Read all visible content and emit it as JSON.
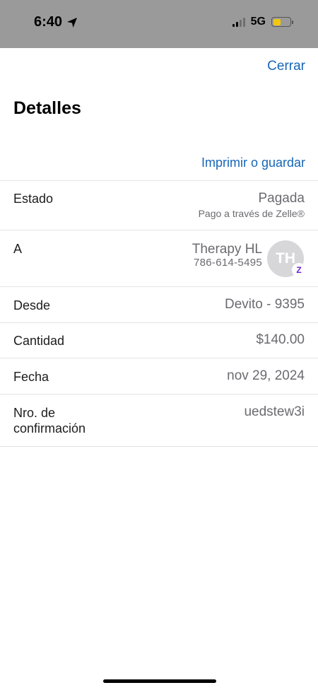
{
  "status_bar": {
    "time": "6:40",
    "network": "5G",
    "battery_level": 0.45,
    "colors": {
      "battery_fill": "#f2c70d",
      "bar_bg": "#9a9a9a"
    },
    "icons": [
      "location-arrow-icon",
      "signal-icon",
      "battery-icon"
    ]
  },
  "header": {
    "close_label": "Cerrar",
    "title": "Detalles",
    "print_label": "Imprimir o guardar"
  },
  "details": {
    "estado": {
      "label": "Estado",
      "value": "Pagada",
      "sub": "Pago a través de Zelle®"
    },
    "a": {
      "label": "A",
      "name": "Therapy HL",
      "phone": "786-614-5495",
      "avatar_initials": "TH",
      "badge": "Z"
    },
    "desde": {
      "label": "Desde",
      "value": "Devito - 9395"
    },
    "cantidad": {
      "label": "Cantidad",
      "value": "$140.00"
    },
    "fecha": {
      "label": "Fecha",
      "value": "nov 29, 2024"
    },
    "confirmacion": {
      "label_line1": "Nro. de",
      "label_line2": "confirmación",
      "value": "uedstew3i"
    }
  },
  "colors": {
    "accent": "#1766b5",
    "zelle_purple": "#6d1ed4",
    "value_gray": "#6b6b70"
  }
}
